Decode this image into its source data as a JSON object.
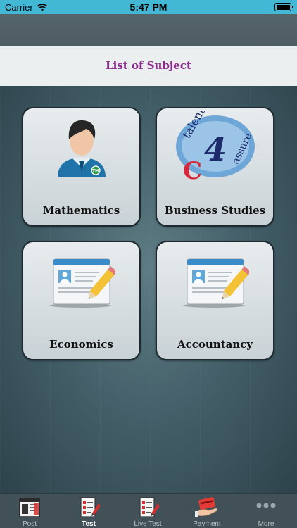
{
  "status_bar": {
    "carrier": "Carrier",
    "time": "5:47 PM"
  },
  "header": {
    "title": "List of Subject"
  },
  "subjects": [
    {
      "label": "Mathematics",
      "icon": "student-avatar-icon"
    },
    {
      "label": "Business Studies",
      "icon": "talent4assure-logo"
    },
    {
      "label": "Economics",
      "icon": "id-card-pencil-icon"
    },
    {
      "label": "Accountancy",
      "icon": "id-card-pencil-icon"
    }
  ],
  "logo_text": {
    "top": "talent",
    "digit": "4",
    "bottom": "assure",
    "letter": "C"
  },
  "tabs": [
    {
      "label": "Post",
      "icon": "post-icon"
    },
    {
      "label": "Test",
      "icon": "test-checklist-icon",
      "active": true
    },
    {
      "label": "Live Test",
      "icon": "live-test-checklist-icon"
    },
    {
      "label": "Payment",
      "icon": "payment-hand-card-icon"
    },
    {
      "label": "More",
      "icon": "more-dots-icon"
    }
  ],
  "colors": {
    "status_bar": "#42b8d4",
    "title": "#8a2a8c",
    "tab_bar": "#425158",
    "background": "#3e545b"
  }
}
